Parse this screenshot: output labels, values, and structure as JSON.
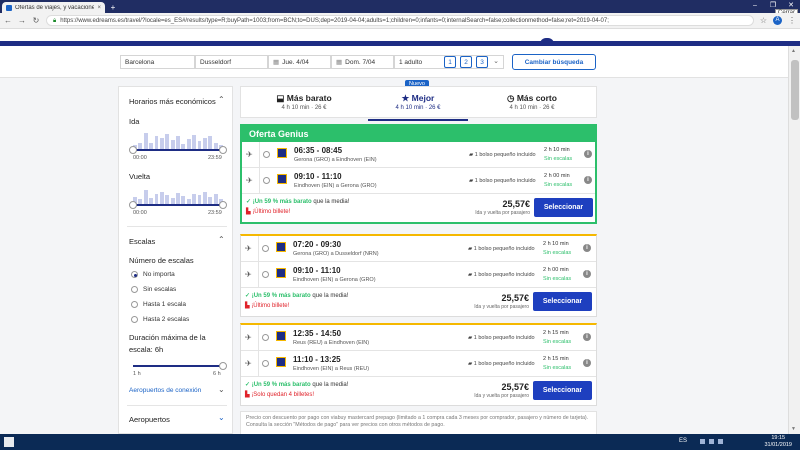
{
  "browser": {
    "tab_title": "Ofertas de viajes, y vacaciones -",
    "tab_close": "×",
    "new_tab": "+",
    "close_tooltip": "Cerrar",
    "url": "https://www.edreams.es/travel/?locale=es_ES#/results/type=R;buyPath=1003;from=BCN;to=DUS;dep=2019-04-04;adults=1;children=0;infants=0;internalSearch=false;collectionmethod=false;ret=2019-04-07;",
    "avatar_letter": "A"
  },
  "search": {
    "origin": "Barcelona",
    "destination": "Dusseldorf",
    "departure": "Jue. 4/04",
    "return": "Dom. 7/04",
    "passengers": "1 adulto",
    "pax_options": [
      "1",
      "2",
      "3"
    ],
    "change_button": "Cambiar búsqueda"
  },
  "sidebar": {
    "schedules_title": "Horarios más económicos",
    "outbound_label": "Ida",
    "outbound_from": "00:00",
    "outbound_to": "23:59",
    "return_label": "Vuelta",
    "return_from": "00:00",
    "return_to": "23:59",
    "stops_title": "Escalas",
    "num_stops_label": "Número de escalas",
    "stop_options": [
      "No importa",
      "Sin escalas",
      "Hasta 1 escala",
      "Hasta 2 escalas"
    ],
    "duration_label_1": "Duración máxima de la",
    "duration_label_2": "escala:",
    "duration_value": "6h",
    "duration_min": "1 h",
    "duration_max": "6 h",
    "airports_link": "Aeropuertos de conexión",
    "airports_title": "Aeropuertos"
  },
  "sort_tabs": {
    "new_badge": "Nuevo",
    "cheapest": {
      "label": "Más barato",
      "value": "4 h 10 min · 26 €"
    },
    "best": {
      "label": "Mejor",
      "value": "4 h 10 min · 26 €"
    },
    "shortest": {
      "label": "Más corto",
      "value": "4 h 10 min · 26 €"
    }
  },
  "offers": [
    {
      "header": "Oferta Genius",
      "legs": [
        {
          "times": "06:35 - 08:45",
          "route": "Gerona (GRO) a Eindhoven (EIN)",
          "baggage": "1 bolso pequeño incluido",
          "duration": "2 h 10 min",
          "stops": "Sin escalas"
        },
        {
          "times": "09:10 - 11:10",
          "route": "Eindhoven (EIN) a Gerona (GRO)",
          "baggage": "1 bolso pequeño incluido",
          "duration": "2 h 00 min",
          "stops": "Sin escalas"
        }
      ],
      "cheaper_strong": "¡Un 59 % más barato",
      "cheaper_rest": " que la media!",
      "alert": "¡Último billete!",
      "price": "25,57€",
      "price_note": "Ida y vuelta por pasajero",
      "button": "Seleccionar"
    },
    {
      "header": "",
      "legs": [
        {
          "times": "07:20 - 09:30",
          "route": "Gerona (GRO) a Dusseldorf (NRN)",
          "baggage": "1 bolso pequeño incluido",
          "duration": "2 h 10 min",
          "stops": "Sin escalas"
        },
        {
          "times": "09:10 - 11:10",
          "route": "Eindhoven (EIN) a Gerona (GRO)",
          "baggage": "1 bolso pequeño incluido",
          "duration": "2 h 00 min",
          "stops": "Sin escalas"
        }
      ],
      "cheaper_strong": "¡Un 59 % más barato",
      "cheaper_rest": " que la media!",
      "alert": "¡Último billete!",
      "price": "25,57€",
      "price_note": "Ida y vuelta por pasajero",
      "button": "Seleccionar"
    },
    {
      "header": "",
      "legs": [
        {
          "times": "12:35 - 14:50",
          "route": "Reus (REU) a Eindhoven (EIN)",
          "baggage": "1 bolso pequeño incluido",
          "duration": "2 h 15 min",
          "stops": "Sin escalas"
        },
        {
          "times": "11:10 - 13:25",
          "route": "Eindhoven (EIN) a Reus (REU)",
          "baggage": "1 bolso pequeño incluido",
          "duration": "2 h 15 min",
          "stops": "Sin escalas"
        }
      ],
      "cheaper_strong": "¡Un 59 % más barato",
      "cheaper_rest": " que la media!",
      "alert": "¡Solo quedan 4 billetes!",
      "price": "25,57€",
      "price_note": "Ida y vuelta por pasajero",
      "button": "Seleccionar"
    }
  ],
  "footnote_1": "Precio con descuento por pago con viabuy mastercard prepago (limitado a 1 compra cada 3 meses por comprador, pasajero y número de tarjeta).",
  "footnote_2": "Consulta la sección \"Métodos de pago\" para ver precios con otros métodos de pago.",
  "taskbar": {
    "language": "ES",
    "time": "19:15",
    "date": "31/01/2019"
  },
  "colors": {
    "brand_navy": "#1e2d84",
    "genius_green": "#2cbf6b",
    "alert_red": "#e0222a",
    "button_blue": "#1e3fbf",
    "gold": "#f5b800"
  }
}
